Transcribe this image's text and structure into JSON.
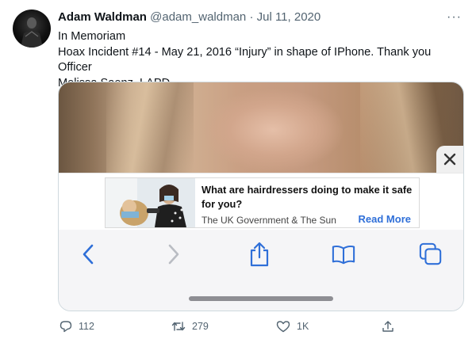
{
  "tweet": {
    "author_name": "Adam Waldman",
    "handle": "@adam_waldman",
    "separator": "·",
    "date": "Jul 11, 2020",
    "more_label": "···",
    "text_lines": [
      "In Memoriam",
      "Hoax Incident #14 - May 21, 2016 “Injury” in shape of IPhone. Thank you Officer",
      "Melissa Saenz, LAPD."
    ]
  },
  "media": {
    "ad": {
      "title": "What are hairdressers doing to make it safe for you?",
      "source": "The UK Government & The Sun",
      "read_more": "Read More"
    },
    "toolbar_icons": [
      "back-chevron-icon",
      "forward-chevron-icon",
      "share-icon",
      "bookmarks-icon",
      "tabs-icon"
    ],
    "accent_color": "#2f6fd8"
  },
  "actions": {
    "replies": "112",
    "retweets": "279",
    "likes": "1K"
  }
}
